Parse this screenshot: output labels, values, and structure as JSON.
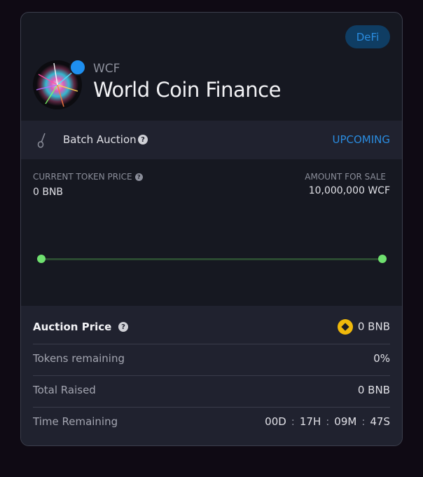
{
  "project": {
    "category": "DeFi",
    "symbol": "WCF",
    "name": "World Coin Finance"
  },
  "auction": {
    "type_label": "Batch Auction",
    "status": "UPCOMING"
  },
  "pricing": {
    "current_price_label": "CURRENT TOKEN PRICE",
    "current_price_value": "0 BNB",
    "amount_for_sale_label": "AMOUNT FOR SALE",
    "amount_for_sale_value": "10,000,000 WCF"
  },
  "details": {
    "auction_price_label": "Auction Price",
    "auction_price_value": "0 BNB",
    "tokens_remaining_label": "Tokens remaining",
    "tokens_remaining_value": "0%",
    "total_raised_label": "Total Raised",
    "total_raised_value": "0 BNB",
    "time_remaining_label": "Time Remaining",
    "time_remaining": {
      "days": "00D",
      "hours": "17H",
      "minutes": "09M",
      "seconds": "47S"
    }
  },
  "colors": {
    "accent": "#2a8ce0",
    "progress": "#6fe06f",
    "card_background": "#161821"
  }
}
